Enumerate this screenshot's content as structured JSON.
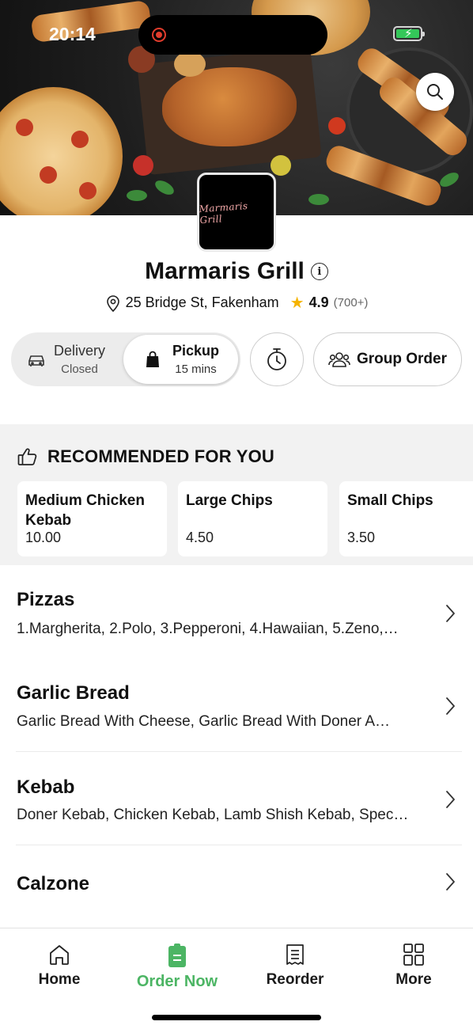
{
  "status_bar": {
    "time": "20:14",
    "battery_color": "#34c759",
    "recording_color": "#e03c2c"
  },
  "hero": {
    "search_icon": "search-icon"
  },
  "restaurant": {
    "logo_text": "Marmaris Grill",
    "name": "Marmaris Grill",
    "address": "25 Bridge St, Fakenham",
    "rating": "4.9",
    "rating_count": "(700+)",
    "star_color": "#f5b300"
  },
  "order_mode": {
    "delivery": {
      "label": "Delivery",
      "status": "Closed",
      "icon": "car-icon"
    },
    "pickup": {
      "label": "Pickup",
      "status": "15 mins",
      "icon": "bag-icon",
      "selected": true
    },
    "timer_icon": "stopwatch-icon",
    "group_order_label": "Group Order",
    "group_order_icon": "group-icon"
  },
  "recommended": {
    "heading": "RECOMMENDED FOR YOU",
    "icon": "thumbs-up-icon",
    "items": [
      {
        "name": "Medium Chicken Kebab",
        "price": "10.00"
      },
      {
        "name": "Large Chips",
        "price": "4.50"
      },
      {
        "name": "Small Chips",
        "price": "3.50"
      }
    ]
  },
  "categories": [
    {
      "name": "Pizzas",
      "description": "1.Margherita, 2.Polo, 3.Pepperoni, 4.Hawaiian, 5.Zeno,…"
    },
    {
      "name": "Garlic Bread",
      "description": "Garlic Bread With Cheese, Garlic Bread With Doner A…"
    },
    {
      "name": "Kebab",
      "description": "Doner Kebab, Chicken Kebab, Lamb Shish Kebab, Spec…"
    },
    {
      "name": "Calzone",
      "description": ""
    }
  ],
  "bottom_nav": {
    "accent_color": "#4cb564",
    "items": [
      {
        "label": "Home",
        "icon": "home-icon"
      },
      {
        "label": "Order Now",
        "icon": "order-icon",
        "active": true
      },
      {
        "label": "Reorder",
        "icon": "receipt-icon"
      },
      {
        "label": "More",
        "icon": "grid-icon"
      }
    ]
  }
}
